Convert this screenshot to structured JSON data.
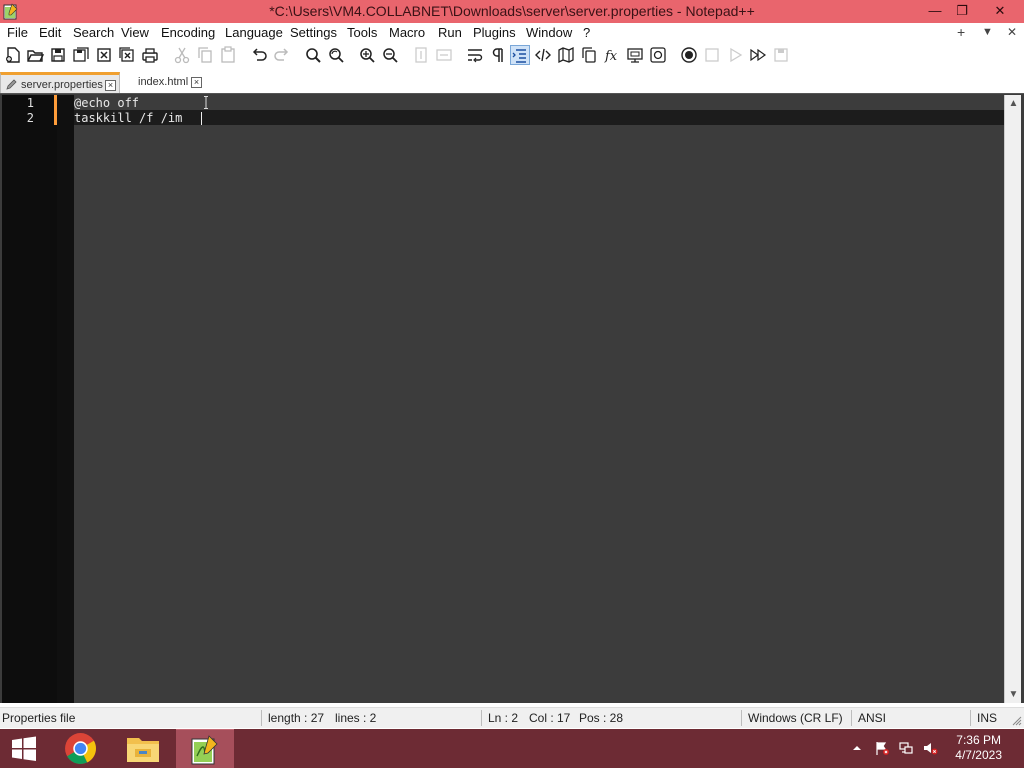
{
  "window": {
    "title": "*C:\\Users\\VM4.COLLABNET\\Downloads\\server\\server.properties - Notepad++",
    "minimize": "—",
    "restore": "❐",
    "close": "✕"
  },
  "menu": {
    "items": [
      "File",
      "Edit",
      "Search",
      "View",
      "Encoding",
      "Language",
      "Settings",
      "Tools",
      "Macro",
      "Run",
      "Plugins",
      "Window",
      "?"
    ],
    "add": "+",
    "down": "▼",
    "close": "✕"
  },
  "toolbar": {
    "icons": [
      "new-file-icon",
      "open-file-icon",
      "save-icon",
      "save-all-icon",
      "close-icon",
      "close-all-icon",
      "print-icon",
      "cut-icon",
      "copy-icon",
      "paste-icon",
      "undo-icon",
      "redo-icon",
      "find-icon",
      "replace-icon",
      "zoom-in-icon",
      "zoom-out-icon",
      "sync-vertical-icon",
      "sync-horizontal-icon",
      "word-wrap-icon",
      "show-all-chars-icon",
      "indent-guide-icon",
      "xml-tag-icon",
      "document-map-icon",
      "document-list-icon",
      "function-list-icon",
      "folder-workspace-icon",
      "monitoring-icon",
      "record-macro-icon",
      "stop-macro-icon",
      "play-macro-icon",
      "run-macro-multiple-icon",
      "save-macro-icon"
    ],
    "active_icon": "indent-guide-icon"
  },
  "tabs": [
    {
      "label": "server.properties",
      "active": true,
      "modified": true
    },
    {
      "label": "index.html",
      "active": false,
      "modified": false
    }
  ],
  "editor": {
    "lines": [
      {
        "number": "1",
        "text": "@echo off"
      },
      {
        "number": "2",
        "text": "taskkill /f /im "
      }
    ],
    "current_line": 2
  },
  "status": {
    "file_type": "Properties file",
    "length": "length : 27",
    "lines": "lines : 2",
    "ln": "Ln : 2",
    "col": "Col : 17",
    "pos": "Pos : 28",
    "eol": "Windows (CR LF)",
    "encoding": "ANSI",
    "mode": "INS"
  },
  "taskbar": {
    "apps": [
      "windows-start-icon",
      "chrome-icon",
      "file-explorer-icon",
      "notepadpp-icon"
    ],
    "time": "7:36 PM",
    "date": "4/7/2023"
  },
  "colors": {
    "titlebar": "#e9656d",
    "taskbar": "#6d2b34",
    "editor_bg": "#3c3c3c",
    "change_marker": "#ff9d3a"
  }
}
